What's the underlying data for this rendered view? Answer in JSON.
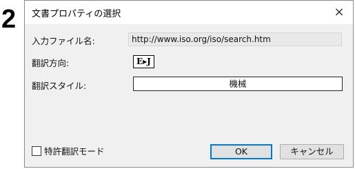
{
  "step_number": "2",
  "dialog": {
    "title": "文書プロパティの選択",
    "close_glyph": "×",
    "input_file_label": "入力ファイル名:",
    "input_file_value": "http://www.iso.org/iso/search.htm",
    "direction_label": "翻訳方向:",
    "direction_value": "E▸J",
    "style_label": "翻訳スタイル:",
    "style_value": "機械",
    "patent_mode_label": "特許翻訳モード",
    "ok_label": "OK",
    "cancel_label": "キャンセル"
  },
  "colors": {
    "dialog_bg": "#f0f0f0",
    "accent": "#0078d7"
  }
}
